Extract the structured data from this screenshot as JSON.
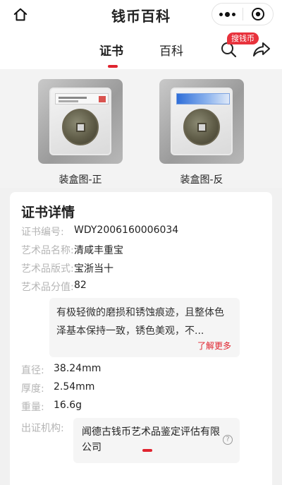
{
  "header": {
    "title": "钱币百科",
    "icons": {
      "home": "home-icon",
      "more": "more-dots-icon",
      "close": "target-close-icon"
    }
  },
  "tabs": [
    {
      "label": "证书",
      "active": true
    },
    {
      "label": "百科",
      "active": false
    }
  ],
  "search": {
    "badge": "搜钱币",
    "icon": "search-icon"
  },
  "share": {
    "icon": "share-icon"
  },
  "images": {
    "front_caption": "装盒图-正",
    "back_caption": "装盒图-反"
  },
  "details": {
    "title": "证书详情",
    "fields": [
      {
        "label": "证书编号:",
        "value": "WDY2006160006034"
      },
      {
        "label": "艺术品名称:",
        "value": "清咸丰重宝"
      },
      {
        "label": "艺术品版式:",
        "value": "宝浙当十"
      },
      {
        "label": "艺术品分值:",
        "value": "82"
      }
    ],
    "description": "有极轻微的磨损和锈蚀痕迹，且整体色泽基本保持一致，锈色美观，不...",
    "more_label": "了解更多",
    "specs": [
      {
        "label": "直径:",
        "value": "38.24mm"
      },
      {
        "label": "厚度:",
        "value": "2.54mm"
      },
      {
        "label": "重量:",
        "value": "16.6g"
      }
    ],
    "issuer_label": "出证机构:",
    "issuer_value": "闻德古钱币艺术品鉴定评估有限公司",
    "help_glyph": "?"
  },
  "colors": {
    "accent": "#e0242f",
    "badge": "#e8323c",
    "muted_label": "#b5b5b5",
    "page_bg": "#f1f1f1"
  }
}
